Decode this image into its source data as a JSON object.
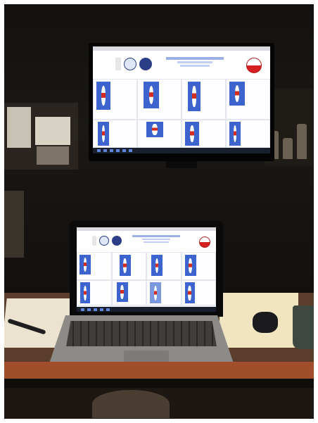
{
  "scene": {
    "description_items": {
      "room": "dark room",
      "objects": [
        "monitor",
        "laptop",
        "table",
        "mouse",
        "mug",
        "paper",
        "pen",
        "shelves"
      ]
    }
  },
  "colors": {
    "koi_blue": "#3d63cf",
    "koi_red": "#d42c1e",
    "headline_blue": "#2849a8",
    "table_wood": "#a04e2c"
  },
  "icons": [
    "koi-photo-icon",
    "club-logo-icon",
    "flag-icon",
    "red-white-logo-icon",
    "taskbar-app-icon"
  ]
}
